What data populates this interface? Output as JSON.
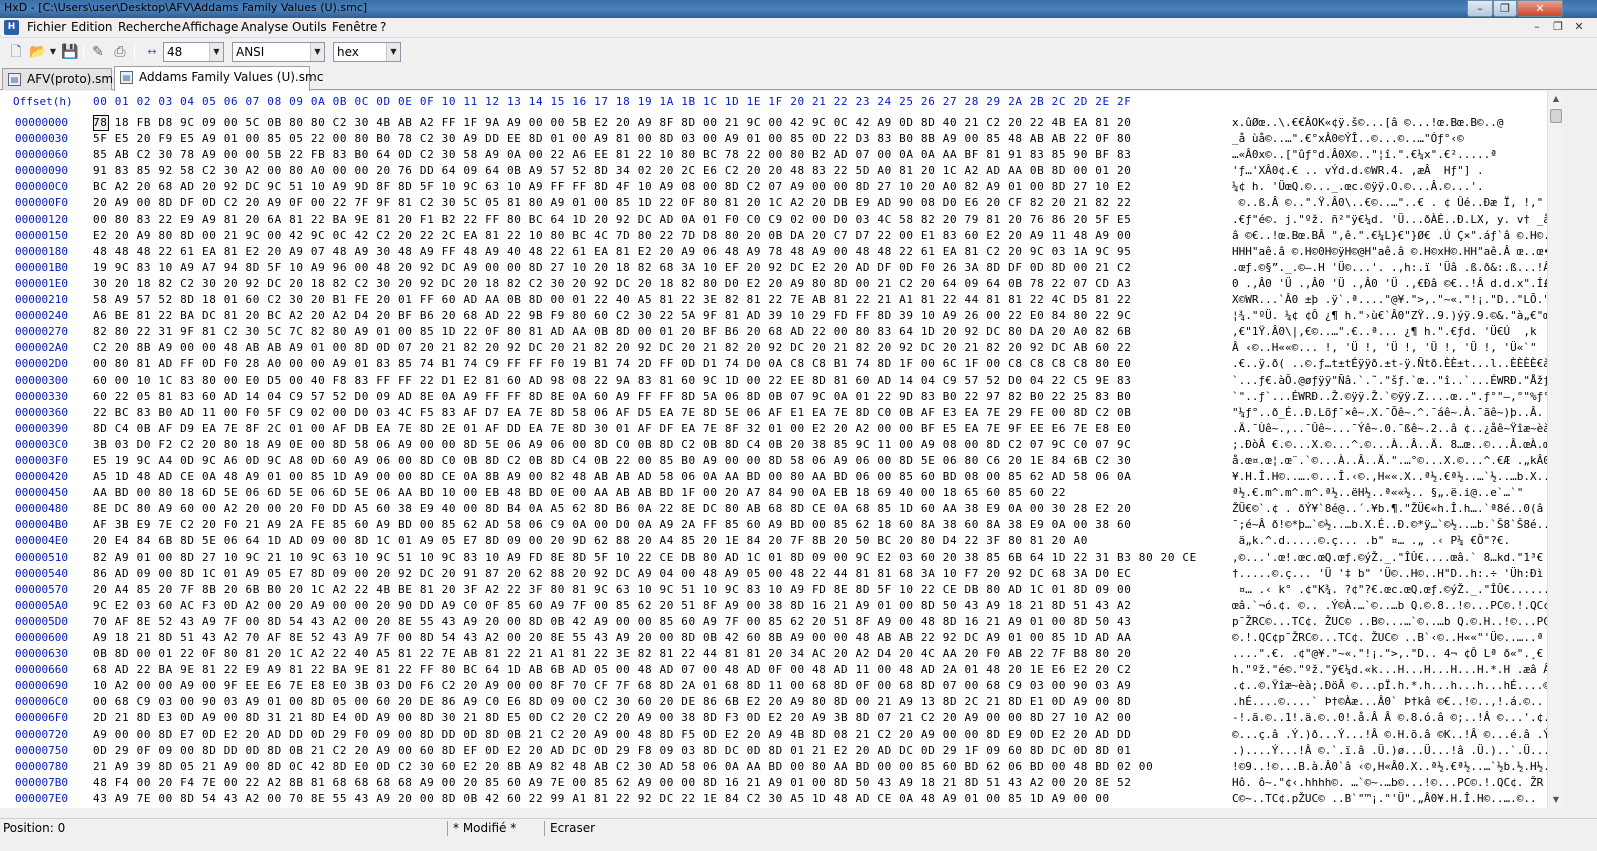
{
  "window": {
    "title": "HxD - [C:\\Users\\user\\Desktop\\AFV\\Addams Family Values (U).smc]",
    "min_glyph": "–",
    "max_glyph": "❐",
    "close_glyph": "✕"
  },
  "menu": {
    "items": [
      "Fichier",
      "Edition",
      "Recherche",
      "Affichage",
      "Analyse",
      "Outils",
      "Fenêtre",
      "?"
    ],
    "mdi_min": "–",
    "mdi_restore": "❐",
    "mdi_close": "✕"
  },
  "toolbar": {
    "bytes_per_row": "48",
    "charset": "ANSI",
    "offset_base": "hex"
  },
  "tabs": [
    {
      "label": "AFV(proto).smc",
      "active": false
    },
    {
      "label": "Addams Family Values (U).smc",
      "active": true
    }
  ],
  "editor": {
    "offset_header": "Offset(h)",
    "column_header": "00 01 02 03 04 05 06 07 08 09 0A 0B 0C 0D 0E 0F 10 11 12 13 14 15 16 17 18 19 1A 1B 1C 1D 1E 1F 20 21 22 23 24 25 26 27 28 29 2A 2B 2C 2D 2E 2F",
    "rows": [
      {
        "offset": "00000000",
        "hex": "78 18 FB D8 9C 09 00 5C 0B 80 80 C2 30 4B AB A2 FF 1F 9A A9 00 00 5B E2 20 A9 8F 8D 00 21 9C 00 42 9C 0C 42 A9 0D 8D 40 21 C2 20 22 4B EA 81 20",
        "ascii": "x.ûØœ..\\.€€ÂOK«¢ÿ.š©...[â ©...!œ.Bœ.B©..@"
      },
      {
        "offset": "00000030",
        "hex": "5F E5 20 F9 E5 A9 01 00 85 05 22 00 80 B0 78 C2 30 A9 DD EE 8D 01 00 A9 81 00 8D 03 00 A9 01 00 85 0D 22 D3 83 B0 8B A9 00 85 48 AB AB 22 0F 80",
        "ascii": "_å ùå©..…\".€°xÂ0©ÝÎ..©...©..…\"Óƒ°‹©"
      },
      {
        "offset": "00000060",
        "hex": "85 AB C2 30 78 A9 00 00 5B 22 FB 83 B0 64 0D C2 30 58 A9 0A 00 22 A6 EE 81 22 10 80 BC 78 22 00 80 B2 AD 07 00 0A 0A AA BF 81 91 83 85 90 BF 83",
        "ascii": "…«Â0x©..[\"ûƒ°d.Â0X©..\"¦î.\".€¼x\".€².....ª"
      },
      {
        "offset": "00000090",
        "hex": "91 83 85 92 58 C2 30 A2 00 80 A0 00 00 20 76 DD 64 09 64 0B A9 57 52 8D 34 02 20 2C E6 C2 20 20 48 83 22 5D A0 81 20 1C A2 AD AA 0B 8D 00 01 20",
        "ascii": "'ƒ…'XÂ0¢.€ .. vÝd.d.©WR.4. ,æÂ  Hƒ\"] . "
      },
      {
        "offset": "000000C0",
        "hex": "BC A2 20 68 AD 20 92 DC 9C 51 10 A9 9D 8F 8D 5F 10 9C 63 10 A9 FF FF 8D 4F 10 A9 08 00 8D C2 07 A9 00 00 8D 27 10 20 A0 82 A9 01 00 8D 27 10 E2",
        "ascii": "¼¢ h. 'ÜœQ.©..._.œc.©ÿÿ.O.©...Â.©...'."
      },
      {
        "offset": "000000F0",
        "hex": "20 A9 00 8D DF 0D C2 20 A9 0F 00 22 7F 9F 81 C2 30 5C 05 81 80 A9 01 00 85 1D 22 0F 80 81 20 1C A2 20 DB E9 AD 90 08 D0 E6 20 CF 82 20 21 82 22",
        "ascii": " ©..ß.Â ©..\".Ÿ.Â0\\..€©..…\"..€ . ¢ Ûé..Ðæ Ï‚ !‚\""
      },
      {
        "offset": "00000120",
        "hex": "00 80 83 22 E9 A9 81 20 6A 81 22 BA 9E 81 20 F1 B2 22 FF 80 BC 64 1D 20 92 DC AD 0A 01 F0 C0 C9 02 00 D0 03 4C 58 82 20 79 81 20 76 86 20 5F E5",
        "ascii": ".€ƒ\"é©. j.\"ºž. ñ²\"ÿ€¼d. 'Ü...ðÀÉ..Ð.LX‚ y. v† _å"
      },
      {
        "offset": "00000150",
        "hex": "E2 20 A9 80 8D 00 21 9C 00 42 9C 0C 42 C2 20 22 2C EA 81 22 10 80 BC 4C 7D 80 22 7D D8 80 20 0B DA 20 C7 D7 22 00 E1 83 60 E2 20 A9 11 48 A9 00",
        "ascii": "â ©€..!œ.Bœ.BÂ \",ê.\".€¼L}€\"}Ø€ .Ú Ç×\".áƒ`â ©.H©."
      },
      {
        "offset": "00000180",
        "hex": "48 48 48 22 61 EA 81 E2 20 A9 07 48 A9 30 48 A9 FF 48 A9 40 48 22 61 EA 81 E2 20 A9 06 48 A9 78 48 A9 00 48 48 22 61 EA 81 C2 20 9C 03 1A 9C 95",
        "ascii": "HHH\"aê.â ©.H©0H©ÿH©@H\"aê.â ©.H©xH©.HH\"aê.Â œ..œ•"
      },
      {
        "offset": "000001B0",
        "hex": "19 9C 83 10 A9 A7 94 8D 5F 10 A9 96 00 48 20 92 DC A9 00 00 8D 27 10 20 18 82 68 3A 10 EF 20 92 DC E2 20 AD DF 0D F0 26 3A 8D DF 0D 8D 00 21 C2",
        "ascii": ".œƒ.©§”._.©–.H 'Ü©...'. .‚h:.ï 'Üâ .ß.ð&:.ß...!Â"
      },
      {
        "offset": "000001E0",
        "hex": "30 20 18 82 C2 30 20 92 DC 20 18 82 C2 30 20 92 DC 20 18 82 C2 30 20 92 DC 20 18 82 80 D0 E2 20 A9 80 8D 00 21 C2 20 64 09 64 0B 78 22 07 CD A3",
        "ascii": "0 .‚Â0 'Ü .‚Â0 'Ü .‚Â0 'Ü .‚€Ðâ ©€..!Â d.d.x\".Í£"
      },
      {
        "offset": "00000210",
        "hex": "58 A9 57 52 8D 18 01 60 C2 30 20 B1 FE 20 01 FF 60 AD AA 0B 8D 00 01 22 40 A5 81 22 3E 82 81 22 7E AB 81 22 21 A1 81 22 44 81 81 22 4C D5 81 22",
        "ascii": "X©WR...`Â0 ±þ .ÿ`.ª....\"@¥.\">‚.\"~«.\"!¡.\"D..\"LÕ.\""
      },
      {
        "offset": "00000240",
        "hex": "A6 BE 81 22 BA DC 81 20 BC A2 20 A2 D4 20 BF B6 20 68 AD 22 9B F9 80 60 C2 30 22 5A 9F 81 AD 39 10 29 FD FF 8D 39 10 A9 26 00 22 E0 84 80 22 9C",
        "ascii": "¦¾.\"ºÜ. ¼¢ ¢Ô ¿¶ h.\"›ù€`Â0\"ZŸ..9.)ýÿ.9.©&.\"à„€\"œ"
      },
      {
        "offset": "00000270",
        "hex": "82 80 22 31 9F 81 C2 30 5C 7C 82 80 A9 01 00 85 1D 22 0F 80 81 AD AA 0B 8D 00 01 20 BF B6 20 68 AD 22 00 80 83 64 1D 20 92 DC 80 DA 20 A0 82 6B",
        "ascii": "‚€\"1Ÿ.Â0\\|‚€©..…\".€..ª... ¿¶ h.\".€ƒd. 'Ü€Ú  ‚k"
      },
      {
        "offset": "000002A0",
        "hex": "C2 20 8B A9 00 00 48 AB AB A9 01 00 8D 0D 07 20 21 82 20 92 DC 20 21 82 20 92 DC 20 21 82 20 92 DC 20 21 82 20 92 DC 20 21 82 20 92 DC AB 60 22",
        "ascii": "Â ‹©..H««©... !‚ 'Ü !‚ 'Ü !‚ 'Ü !‚ 'Ü !‚ 'Ü«`\""
      },
      {
        "offset": "000002D0",
        "hex": "00 80 81 AD FF 0D F0 28 A0 00 00 A9 01 83 85 74 B1 74 C9 FF FF F0 19 B1 74 2D FF 0D D1 74 D0 0A C8 C8 B1 74 8D 1F 00 6C 1F 00 C8 C8 C8 C8 80 E0",
        "ascii": ".€..ÿ.ð( ..©.ƒ…t±tÉÿÿð.±t-ÿ.Ñtð.ÈÈ±t...l..ÈÈÈÈ€à"
      },
      {
        "offset": "00000300",
        "hex": "60 00 10 1C 83 80 00 E0 D5 00 40 F8 83 FF FF 22 D1 E2 81 60 AD 98 08 22 9A 83 81 60 9C 1D 00 22 EE 8D 81 60 AD 14 04 C9 57 52 D0 04 22 C5 9E 83",
        "ascii": "`...ƒ€.àÕ.@øƒÿÿ\"Ñâ.`.˜.\"šƒ.`œ..\"î..`...ÉWRÐ.\"ÅžƒA"
      },
      {
        "offset": "00000330",
        "hex": "60 22 05 81 83 60 AD 14 04 C9 57 52 D0 09 AD 8E 0A A9 FF FF 8D 8E 0A 60 A9 FF FF 8D 5A 06 8D 0B 07 9C 0A 01 22 9D 83 B0 22 97 82 B0 22 25 83 B0",
        "ascii": "`\"..ƒ`...ÉWRÐ..Ž.©ÿÿ.Ž.`©ÿÿ.Z....œ..\".ƒ°\"—‚°\"%ƒ°"
      },
      {
        "offset": "00000360",
        "hex": "22 BC 83 B0 AD 11 00 F0 5F C9 02 00 D0 03 4C F5 83 AF D7 EA 7E 8D 58 06 AF D5 EA 7E 8D 5E 06 AF E1 EA 7E 8D C0 0B AF E3 EA 7E 29 FE 00 8D C2 0B",
        "ascii": "\"¼ƒ°..ð_É..Ð.Lõƒ¯×ê~.X.¯Õê~.^.¯áê~.À.¯ãê~)þ..Â."
      },
      {
        "offset": "00000390",
        "hex": "8D C4 0B AF D9 EA 7E 8F 2C 01 00 AF DB EA 7E 8D 2E 01 AF DD EA 7E 8D 30 01 AF DF EA 7E 8F 32 01 00 E2 20 A2 00 00 BF E5 EA 7E 9F EE E6 7E E8 E0",
        "ascii": ".Ä.¯Ùê~.,..¯Ûê~...¯Ýê~.0.¯ßê~.2..â ¢..¿åê~Ÿîæ~èà"
      },
      {
        "offset": "000003C0",
        "hex": "3B 03 D0 F2 C2 20 80 18 A9 0E 00 8D 58 06 A9 00 00 8D 5E 06 A9 06 00 8D C0 0B 8D C2 0B 8D C4 0B 20 38 85 9C 11 00 A9 08 00 8D C2 07 9C C0 07 9C",
        "ascii": ";.ÐòÂ €.©...X.©...^.©...À..Â..Ä. 8…œ..©...Â.œÀ.œ"
      },
      {
        "offset": "000003F0",
        "hex": "E5 19 9C A4 0D 9C A6 0D 9C A8 0D 60 A9 06 00 8D C0 0B 8D C2 0B 8D C4 0B 22 00 85 B0 A9 00 00 8D 58 06 A9 06 00 8D 5E 06 80 C6 20 1E 84 6B C2 30",
        "ascii": "å.œ¤.œ¦.œ¨.`©...À..Â..Ä.\".…°©...X.©...^.€Æ .„kÂ0"
      },
      {
        "offset": "00000420",
        "hex": "A5 1D 48 AD CE 0A 48 A9 01 00 85 1D A9 00 00 8D CE 0A 8B A9 00 82 48 AB AB AD 58 06 0A AA BD 00 80 AA BD 06 00 85 60 BD 08 00 85 62 AD 58 06 0A",
        "ascii": "¥.H.Î.H©..….©...Î.‹©.‚H««.X..ª½.€ª½..…`½..…b.X.."
      },
      {
        "offset": "00000450",
        "hex": "AA BD 00 80 18 6D 5E 06 6D 5E 06 6D 5E 06 AA BD 10 00 EB 48 BD 0E 00 AA AB AB BD 1F 00 20 A7 84 90 0A EB 18 69 40 00 18 65 60 85 60 22",
        "ascii": "ª½.€.m^.m^.m^.ª½..ëH½..ª««½.. §„.ë.i@..e`…`\""
      },
      {
        "offset": "00000480",
        "hex": "8E DC 80 A9 60 00 A2 20 00 20 F0 DD A5 60 38 E9 40 00 8D B4 0A A5 62 8D B6 0A 22 8E DC 80 AB 68 8D CE 0A 68 85 1D 60 AA 38 E9 0A 00 30 28 E2 20",
        "ascii": "ŽÜ€©`.¢ . ðÝ¥`8é@..´.¥b.¶.\"ŽÜ€«h.Î.h….`ª8é..0(â "
      },
      {
        "offset": "000004B0",
        "hex": "AF 3B E9 7E C2 20 F0 21 A9 2A FE 85 60 A9 BD 00 85 62 AD 58 06 C9 0A 00 D0 0A A9 2A FF 85 60 A9 BD 00 85 62 18 60 8A 38 60 8A 38 E9 0A 00 38 60",
        "ascii": "¯;é~Â ð!©*þ…`©½..…b.X.É..Ð.©*ÿ…`©½..…b.`Š8`Š8é..8`"
      },
      {
        "offset": "000004E0",
        "hex": "20 E4 84 6B 8D 5E 06 64 1D AD 09 00 8D 1C 01 A9 05 E7 8D 09 00 20 9D 62 88 20 A4 85 20 1E 84 20 7F 8B 20 50 BC 20 80 D4 22 3F 80 81 20 A0",
        "ascii": " ä„k.^.d.....©.ç... .b\" ¤… .„ .‹ P¼ €Ô\"?€.  "
      },
      {
        "offset": "00000510",
        "hex": "82 A9 01 00 8D 27 10 9C 21 10 9C 63 10 9C 51 10 9C 83 10 A9 FD 8E 8D 5F 10 22 CE DB 80 AD 1C 01 8D 09 00 9C E2 03 60 20 38 85 6B 64 1D 22 31 B3 80 20 CE",
        "ascii": "‚©...'.œ!.œc.œQ.œƒ.©ýŽ._.\"ÎÛ€....œâ.` 8…kd.\"1³€ Î"
      },
      {
        "offset": "00000540",
        "hex": "86 AD 09 00 8D 1C 01 A9 05 E7 8D 09 00 20 92 DC 20 91 87 20 62 88 20 92 DC A9 04 00 48 A9 05 00 48 22 44 81 81 68 3A 10 F7 20 92 DC 68 3A D0 EC",
        "ascii": "†.....©.ç... 'Ü '‡ b\" 'Ü©..H©..H\"D..h:.÷ 'Üh:Ðì"
      },
      {
        "offset": "00000570",
        "hex": "20 A4 85 20 7F 8B 20 6B B0 20 1C A2 22 4B BE 81 20 3F A2 22 3F 80 81 9C 63 10 9C 51 10 9C 83 10 A9 FD 8E 8D 5F 10 22 CE DB 80 AD 1C 01 8D 09 00",
        "ascii": " ¤… .‹ k° .¢\"K¾. ?¢\"?€.œc.œQ.œƒ.©ýŽ._.\"ÎÛ€......"
      },
      {
        "offset": "000005A0",
        "hex": "9C E2 03 60 AC F3 0D A2 00 20 A9 00 00 20 90 DD A9 C0 0F 85 60 A9 7F 00 85 62 20 51 8F A9 00 38 8D 16 21 A9 01 00 8D 50 43 A9 18 21 8D 51 43 A2",
        "ascii": "œâ.`¬ó.¢. ©.. .Ý©À.…`©..…b Q.©.8..!©...PC©.!.QC¢"
      },
      {
        "offset": "000005D0",
        "hex": "70 AF 8E 52 43 A9 7F 00 8D 54 43 A2 00 20 8E 55 43 A9 20 00 8D 0B 42 A9 00 00 85 60 A9 7F 00 85 62 20 51 8F A9 00 48 8D 16 21 A9 01 00 8D 50 43",
        "ascii": "p¯ŽRC©...TC¢. ŽUC© ..B©...…`©..…b Q.©.H..!©...PC"
      },
      {
        "offset": "00000600",
        "hex": "A9 18 21 8D 51 43 A2 70 AF 8E 52 43 A9 7F 00 8D 54 43 A2 00 20 8E 55 43 A9 20 00 8D 0B 42 60 8B A9 00 00 48 AB AB 22 92 DC A9 01 00 85 1D AD AA",
        "ascii": "©.!.QC¢p¯ŽRC©...TC¢. ŽUC© ..B`‹©..H««\"'Ü©..…..ª"
      },
      {
        "offset": "00000630",
        "hex": "0B 8D 00 01 22 0F 80 81 20 1C A2 22 40 A5 81 22 7E AB 81 22 21 A1 81 22 3E 82 81 22 44 81 81 20 34 AC 20 A2 D4 20 4C AA 20 F0 AB 22 7F B8 80 20",
        "ascii": "....\".€. .¢\"@¥.\"~«.\"!¡.\">‚.\"D.. 4¬ ¢Ô Lª ð«\".¸€ "
      },
      {
        "offset": "00000660",
        "hex": "68 AD 22 BA 9E 81 22 E9 A9 81 22 BA 9E 81 22 FF 80 BC 64 1D AB 6B AD 05 00 48 AD 07 00 48 AD 0F 00 48 AD 11 00 48 AD 2A 01 48 20 1E E6 E2 20 C2",
        "ascii": "h.\"ºž.\"é©.\"ºž.\"ÿ€¼d.«k...H...H...H...H.*.H .æâ Â"
      },
      {
        "offset": "00000690",
        "hex": "10 A2 00 00 A9 00 9F EE E6 7E E8 E0 3B 03 D0 F6 C2 20 A9 00 00 8F 70 CF 7F 68 8D 2A 01 68 8D 11 00 68 8D 0F 00 68 8D 07 00 68 C9 03 00 90 03 A9",
        "ascii": ".¢..©.Ÿîæ~èà;.ÐöÂ ©...pÏ.h.*.h...h...h...hÉ....©"
      },
      {
        "offset": "000006C0",
        "hex": "00 68 C9 03 00 90 03 A9 01 00 8D 05 00 60 20 DE 86 A9 C0 E6 8D 09 00 C2 30 60 20 DE 86 6B E2 20 A9 80 8D 00 21 A9 13 8D 2C 21 8D E1 0D A9 00 8D",
        "ascii": ".hÉ....©....` Þ†©Àæ...Â0` Þ†kâ ©€..!©..,!.á.©.."
      },
      {
        "offset": "000006F0",
        "hex": "2D 21 8D E3 0D A9 00 8D 31 21 8D E4 0D A9 00 8D 30 21 8D E5 0D C2 20 C2 20 A9 00 38 8D F3 0D E2 20 A9 3B 8D 07 21 C2 20 A9 00 00 8D 27 10 A2 00",
        "ascii": "-!.ã.©..1!.ä.©..0!.å.Â Â ©.8.ó.â ©;..!Â ©...'.¢."
      },
      {
        "offset": "00000720",
        "hex": "A9 00 00 8D E7 0D E2 20 AD DD 0D 29 F0 09 00 8D DD 0D 8D 0B 21 C2 20 A9 00 48 8D F5 0D E2 20 A9 4B 8D 08 21 C2 20 A9 00 00 8D E9 0D E2 20 AD DD",
        "ascii": "©...ç.â .Ý.)ð...Ý...!Â ©.H.õ.â ©K..!Â ©...é.â .Ý"
      },
      {
        "offset": "00000750",
        "hex": "0D 29 0F 09 00 8D DD 0D 8D 0B 21 C2 20 A9 00 60 8D EF 0D E2 20 AD DC 0D 29 F8 09 03 8D DC 0D 8D 01 21 E2 20 AD DC 0D 29 1F 09 60 8D DC 0D 8D 01",
        "ascii": ".)....Ý...!Â ©.`.ï.â .Ü.)ø...Ü...!â .Ü.)..`.Ü..."
      },
      {
        "offset": "00000780",
        "hex": "21 A9 39 8D 05 21 A9 00 8D 0C 42 8D E0 0D C2 30 60 E2 20 8B A9 82 48 AB C2 30 AD 58 06 0A AA BD 00 80 AA BD 00 00 85 60 BD 62 06 BD 00 48 BD 02 00",
        "ascii": "!©9..!©...B.à.Â0`â ‹©‚H«Â0.X..ª½.€ª½..…`½b.½.H½.."
      },
      {
        "offset": "000007B0",
        "hex": "48 F4 00 20 F4 7E 00 22 A2 8B 81 68 68 68 68 A9 00 20 85 60 A9 7E 00 85 62 A9 00 00 8D 16 21 A9 01 00 8D 50 43 A9 18 21 8D 51 43 A2 00 20 8E 52",
        "ascii": "Hô. ô~.\"¢‹.hhhh©. …`©~.…b©...!©...PC©.!.QC¢. ŽR"
      },
      {
        "offset": "000007E0",
        "hex": "43 A9 7E 00 8D 54 43 A2 00 70 8E 55 43 A9 20 00 8D 0B 42 60 22 99 A1 81 22 92 DC 22 1E 84 C2 30 A5 1D 48 AD CE 0A 48 A9 01 00 85 1D A9 00 00",
        "ascii": "C©~..TC¢.pŽUC© ..B`\"™¡.\"'Ü\".„Â0¥.H.Î.H©..….©.."
      }
    ]
  },
  "status": {
    "position": "Position: 0",
    "modified": "* Modifié *",
    "mode": "Ecraser"
  }
}
